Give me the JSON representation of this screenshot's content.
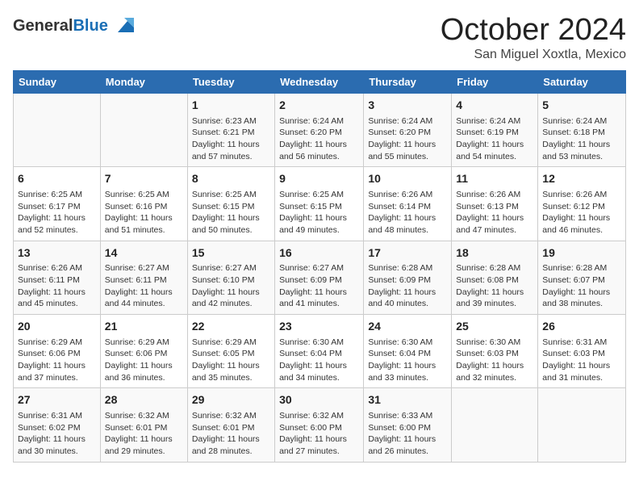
{
  "header": {
    "logo_line1": "General",
    "logo_line2": "Blue",
    "month": "October 2024",
    "location": "San Miguel Xoxtla, Mexico"
  },
  "days_of_week": [
    "Sunday",
    "Monday",
    "Tuesday",
    "Wednesday",
    "Thursday",
    "Friday",
    "Saturday"
  ],
  "weeks": [
    [
      {
        "day": "",
        "sunrise": "",
        "sunset": "",
        "daylight": ""
      },
      {
        "day": "",
        "sunrise": "",
        "sunset": "",
        "daylight": ""
      },
      {
        "day": "1",
        "sunrise": "Sunrise: 6:23 AM",
        "sunset": "Sunset: 6:21 PM",
        "daylight": "Daylight: 11 hours and 57 minutes."
      },
      {
        "day": "2",
        "sunrise": "Sunrise: 6:24 AM",
        "sunset": "Sunset: 6:20 PM",
        "daylight": "Daylight: 11 hours and 56 minutes."
      },
      {
        "day": "3",
        "sunrise": "Sunrise: 6:24 AM",
        "sunset": "Sunset: 6:20 PM",
        "daylight": "Daylight: 11 hours and 55 minutes."
      },
      {
        "day": "4",
        "sunrise": "Sunrise: 6:24 AM",
        "sunset": "Sunset: 6:19 PM",
        "daylight": "Daylight: 11 hours and 54 minutes."
      },
      {
        "day": "5",
        "sunrise": "Sunrise: 6:24 AM",
        "sunset": "Sunset: 6:18 PM",
        "daylight": "Daylight: 11 hours and 53 minutes."
      }
    ],
    [
      {
        "day": "6",
        "sunrise": "Sunrise: 6:25 AM",
        "sunset": "Sunset: 6:17 PM",
        "daylight": "Daylight: 11 hours and 52 minutes."
      },
      {
        "day": "7",
        "sunrise": "Sunrise: 6:25 AM",
        "sunset": "Sunset: 6:16 PM",
        "daylight": "Daylight: 11 hours and 51 minutes."
      },
      {
        "day": "8",
        "sunrise": "Sunrise: 6:25 AM",
        "sunset": "Sunset: 6:15 PM",
        "daylight": "Daylight: 11 hours and 50 minutes."
      },
      {
        "day": "9",
        "sunrise": "Sunrise: 6:25 AM",
        "sunset": "Sunset: 6:15 PM",
        "daylight": "Daylight: 11 hours and 49 minutes."
      },
      {
        "day": "10",
        "sunrise": "Sunrise: 6:26 AM",
        "sunset": "Sunset: 6:14 PM",
        "daylight": "Daylight: 11 hours and 48 minutes."
      },
      {
        "day": "11",
        "sunrise": "Sunrise: 6:26 AM",
        "sunset": "Sunset: 6:13 PM",
        "daylight": "Daylight: 11 hours and 47 minutes."
      },
      {
        "day": "12",
        "sunrise": "Sunrise: 6:26 AM",
        "sunset": "Sunset: 6:12 PM",
        "daylight": "Daylight: 11 hours and 46 minutes."
      }
    ],
    [
      {
        "day": "13",
        "sunrise": "Sunrise: 6:26 AM",
        "sunset": "Sunset: 6:11 PM",
        "daylight": "Daylight: 11 hours and 45 minutes."
      },
      {
        "day": "14",
        "sunrise": "Sunrise: 6:27 AM",
        "sunset": "Sunset: 6:11 PM",
        "daylight": "Daylight: 11 hours and 44 minutes."
      },
      {
        "day": "15",
        "sunrise": "Sunrise: 6:27 AM",
        "sunset": "Sunset: 6:10 PM",
        "daylight": "Daylight: 11 hours and 42 minutes."
      },
      {
        "day": "16",
        "sunrise": "Sunrise: 6:27 AM",
        "sunset": "Sunset: 6:09 PM",
        "daylight": "Daylight: 11 hours and 41 minutes."
      },
      {
        "day": "17",
        "sunrise": "Sunrise: 6:28 AM",
        "sunset": "Sunset: 6:09 PM",
        "daylight": "Daylight: 11 hours and 40 minutes."
      },
      {
        "day": "18",
        "sunrise": "Sunrise: 6:28 AM",
        "sunset": "Sunset: 6:08 PM",
        "daylight": "Daylight: 11 hours and 39 minutes."
      },
      {
        "day": "19",
        "sunrise": "Sunrise: 6:28 AM",
        "sunset": "Sunset: 6:07 PM",
        "daylight": "Daylight: 11 hours and 38 minutes."
      }
    ],
    [
      {
        "day": "20",
        "sunrise": "Sunrise: 6:29 AM",
        "sunset": "Sunset: 6:06 PM",
        "daylight": "Daylight: 11 hours and 37 minutes."
      },
      {
        "day": "21",
        "sunrise": "Sunrise: 6:29 AM",
        "sunset": "Sunset: 6:06 PM",
        "daylight": "Daylight: 11 hours and 36 minutes."
      },
      {
        "day": "22",
        "sunrise": "Sunrise: 6:29 AM",
        "sunset": "Sunset: 6:05 PM",
        "daylight": "Daylight: 11 hours and 35 minutes."
      },
      {
        "day": "23",
        "sunrise": "Sunrise: 6:30 AM",
        "sunset": "Sunset: 6:04 PM",
        "daylight": "Daylight: 11 hours and 34 minutes."
      },
      {
        "day": "24",
        "sunrise": "Sunrise: 6:30 AM",
        "sunset": "Sunset: 6:04 PM",
        "daylight": "Daylight: 11 hours and 33 minutes."
      },
      {
        "day": "25",
        "sunrise": "Sunrise: 6:30 AM",
        "sunset": "Sunset: 6:03 PM",
        "daylight": "Daylight: 11 hours and 32 minutes."
      },
      {
        "day": "26",
        "sunrise": "Sunrise: 6:31 AM",
        "sunset": "Sunset: 6:03 PM",
        "daylight": "Daylight: 11 hours and 31 minutes."
      }
    ],
    [
      {
        "day": "27",
        "sunrise": "Sunrise: 6:31 AM",
        "sunset": "Sunset: 6:02 PM",
        "daylight": "Daylight: 11 hours and 30 minutes."
      },
      {
        "day": "28",
        "sunrise": "Sunrise: 6:32 AM",
        "sunset": "Sunset: 6:01 PM",
        "daylight": "Daylight: 11 hours and 29 minutes."
      },
      {
        "day": "29",
        "sunrise": "Sunrise: 6:32 AM",
        "sunset": "Sunset: 6:01 PM",
        "daylight": "Daylight: 11 hours and 28 minutes."
      },
      {
        "day": "30",
        "sunrise": "Sunrise: 6:32 AM",
        "sunset": "Sunset: 6:00 PM",
        "daylight": "Daylight: 11 hours and 27 minutes."
      },
      {
        "day": "31",
        "sunrise": "Sunrise: 6:33 AM",
        "sunset": "Sunset: 6:00 PM",
        "daylight": "Daylight: 11 hours and 26 minutes."
      },
      {
        "day": "",
        "sunrise": "",
        "sunset": "",
        "daylight": ""
      },
      {
        "day": "",
        "sunrise": "",
        "sunset": "",
        "daylight": ""
      }
    ]
  ]
}
